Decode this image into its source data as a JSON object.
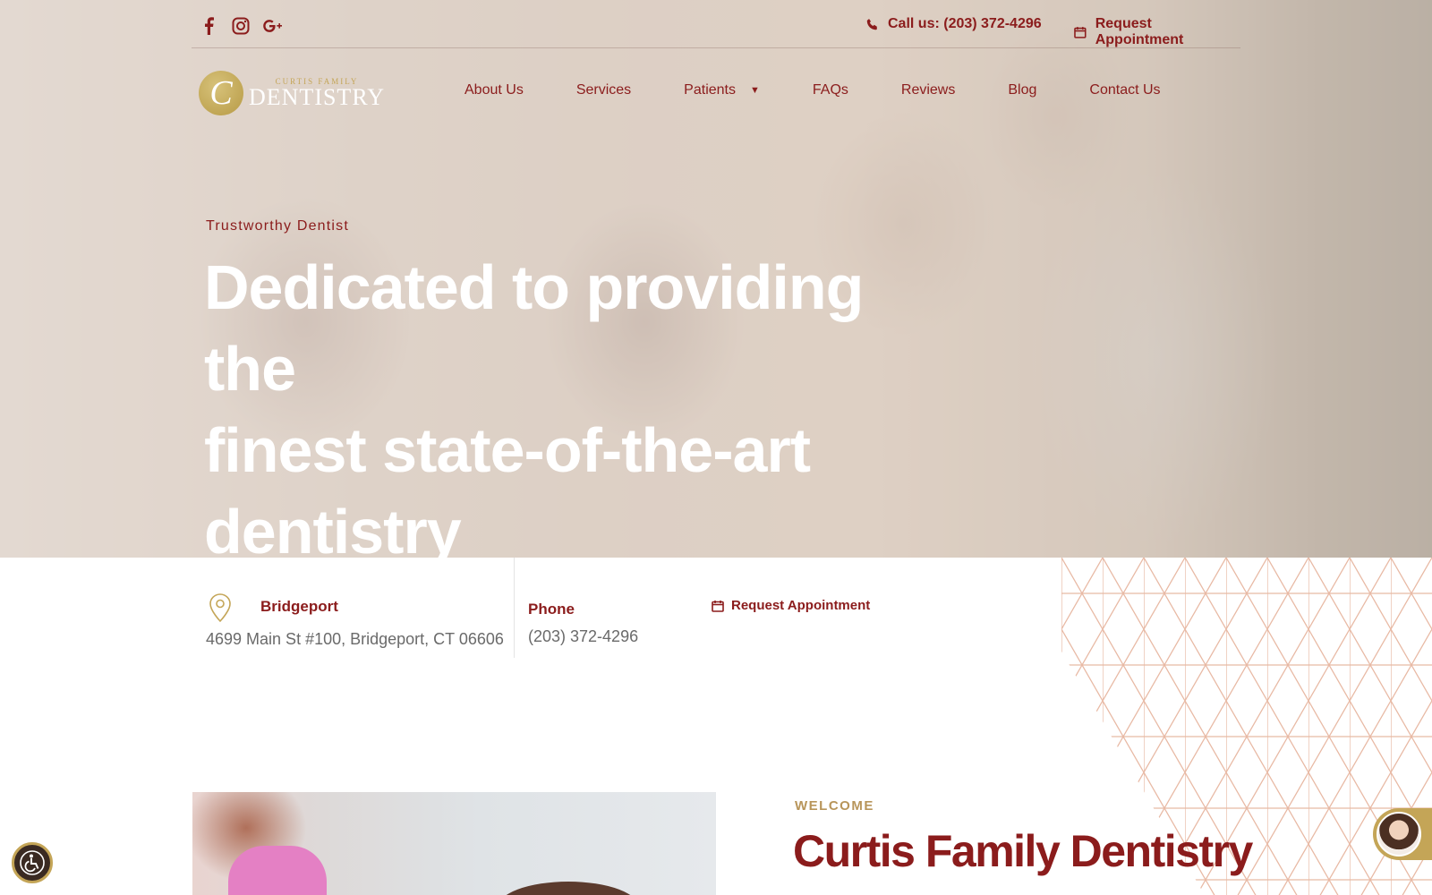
{
  "topbar": {
    "social": [
      {
        "icon": "facebook-icon"
      },
      {
        "icon": "instagram-icon"
      },
      {
        "icon": "google-plus-icon"
      }
    ],
    "call_label": "Call us: (203) 372-4296",
    "request_label": "Request Appointment"
  },
  "logo": {
    "mark": "C",
    "small": "CURTIS FAMILY",
    "big": "DENTISTRY"
  },
  "nav": {
    "items": [
      "About Us",
      "Services",
      "Patients",
      "FAQs",
      "Reviews",
      "Blog",
      "Contact Us"
    ]
  },
  "hero": {
    "eyebrow": "Trustworthy Dentist",
    "headline_line1": "Dedicated to providing the",
    "headline_line2": "finest state-of-the-art",
    "headline_line3": "dentistry"
  },
  "info": {
    "location_title": "Bridgeport",
    "location_address": "4699 Main St #100, Bridgeport, CT 06606",
    "phone_title": "Phone",
    "phone_number": "(203) 372-4296",
    "request_label": "Request Appointment"
  },
  "welcome": {
    "eyebrow": "WELCOME",
    "title": "Curtis Family Dentistry"
  },
  "colors": {
    "brand_red": "#8b1c1c",
    "gold": "#c4a557"
  }
}
